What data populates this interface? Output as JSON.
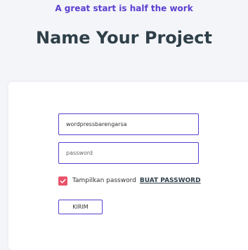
{
  "header": {
    "tagline": "A great start is half the work",
    "title": "Name Your Project"
  },
  "form": {
    "username": {
      "value": "wordpressbarengarsa",
      "placeholder": ""
    },
    "password": {
      "value": "",
      "placeholder": "password"
    },
    "show_password": {
      "label": "Tampilkan password",
      "checked": true
    },
    "generate_password_label": "BUAT PASSWORD",
    "submit_label": "KIRIM"
  },
  "colors": {
    "accent": "#5b3fd0",
    "checkbox": "#e8536a",
    "title": "#2e3f48",
    "background": "#f4f5f9"
  },
  "icons": {
    "checkbox": "checkmark-icon"
  }
}
